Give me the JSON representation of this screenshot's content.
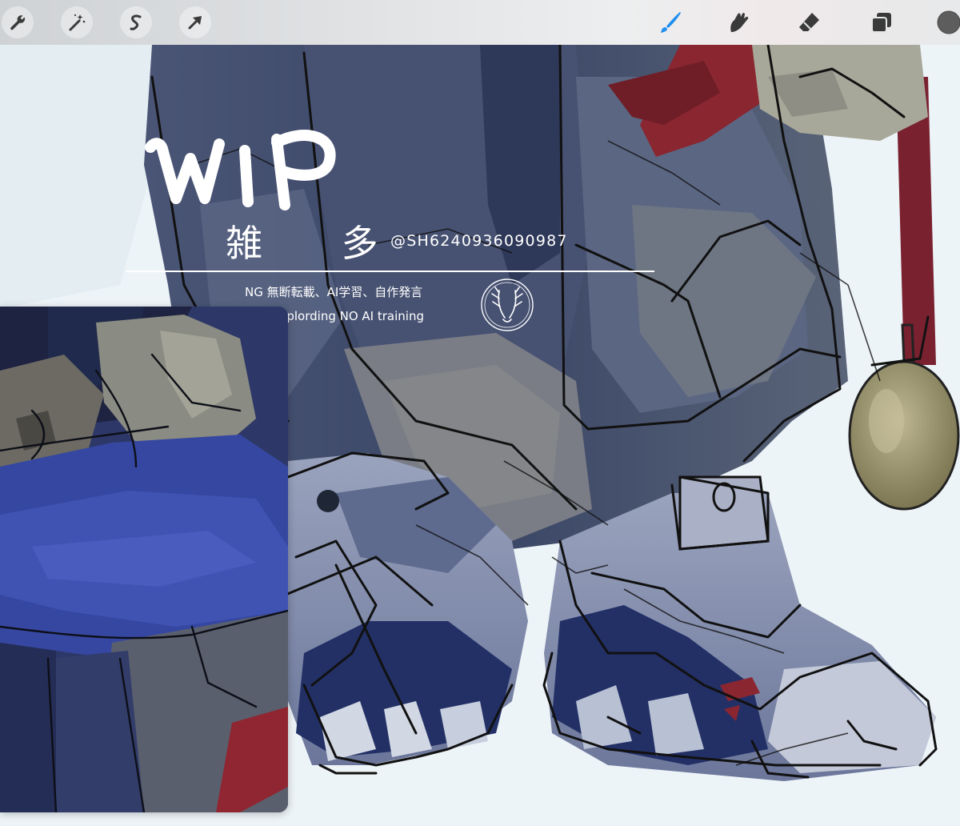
{
  "toolbar": {
    "left_tools": [
      {
        "icon": "wrench-icon"
      },
      {
        "icon": "magic-wand-icon"
      },
      {
        "icon": "selection-icon"
      },
      {
        "icon": "transform-arrow-icon"
      }
    ],
    "right_tools": [
      {
        "icon": "brush-icon",
        "active": true
      },
      {
        "icon": "smudge-icon"
      },
      {
        "icon": "eraser-icon"
      },
      {
        "icon": "layers-icon"
      },
      {
        "icon": "color-swatch-icon"
      }
    ],
    "accent_color": "#1e8ef0",
    "current_color": "#5d5d5d"
  },
  "overlay": {
    "wip_label": "WIP",
    "category": "雑 多",
    "handle": "@SH6240936090987",
    "notice_jp": "NG 無断転載、AI学習、自作発言",
    "notice_en": "NO reuplording NO AI training",
    "crest_icon": "antler-crest-icon"
  },
  "palette": {
    "coat": "#3d4a6b",
    "shoe": "#7f8aa8",
    "accent_red": "#8a2630",
    "medal": "#a09a78",
    "background": "#edf4f8"
  }
}
